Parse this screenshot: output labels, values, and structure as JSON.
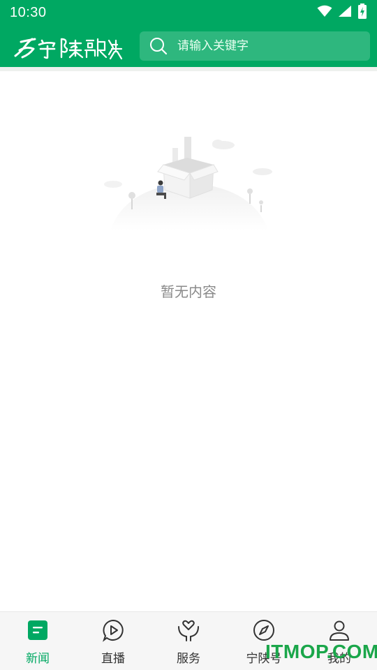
{
  "colors": {
    "brand": "#00a862"
  },
  "status_bar": {
    "time": "10:30",
    "icons": [
      "wifi-icon",
      "signal-icon",
      "battery-charging-icon"
    ]
  },
  "header": {
    "logo_text": "宁陕融媒",
    "search_placeholder": "请输入关键字"
  },
  "empty_state": {
    "message": "暂无内容"
  },
  "bottom_nav": {
    "items": [
      {
        "label": "新闻",
        "icon": "news-icon",
        "active": true
      },
      {
        "label": "直播",
        "icon": "play-icon",
        "active": false
      },
      {
        "label": "服务",
        "icon": "heart-hand-icon",
        "active": false
      },
      {
        "label": "宁陕号",
        "icon": "compass-icon",
        "active": false
      },
      {
        "label": "我的",
        "icon": "person-icon",
        "active": false
      }
    ]
  },
  "watermark": "ITMOP.COM"
}
